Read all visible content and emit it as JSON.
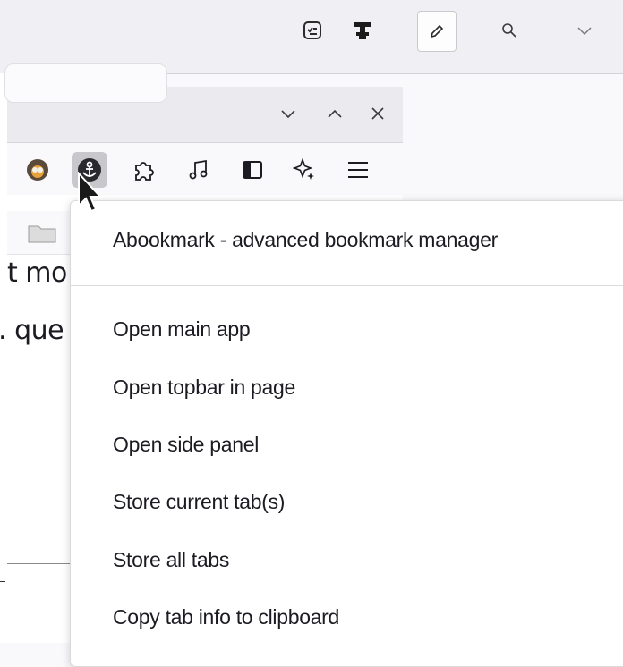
{
  "inner_window": {
    "controls": [
      "chevron-down",
      "chevron-up",
      "close"
    ]
  },
  "page_fragments": [
    "t mo",
    ". que"
  ],
  "context_menu": {
    "header": "Abookmark - advanced bookmark manager",
    "items": [
      "Open main app",
      "Open topbar in page",
      "Open side panel",
      "Store current tab(s)",
      "Store all tabs",
      "Copy tab info to clipboard"
    ]
  },
  "icons": {
    "host_toolbar": [
      "checklist-icon",
      "tree-icon",
      "pen-icon",
      "search-icon",
      "chevron-down-icon"
    ],
    "nav_toolbar": [
      "extension-colorful-icon",
      "anchor-icon",
      "puzzle-icon",
      "music-icon",
      "sidebar-icon",
      "sparkle-icon",
      "menu-icon"
    ]
  },
  "colors": {
    "menu_background": "#ffffff",
    "toolbar_background": "#f0f0f4",
    "pressed_button": "#c8c8cc",
    "text": "#1c1b22"
  }
}
